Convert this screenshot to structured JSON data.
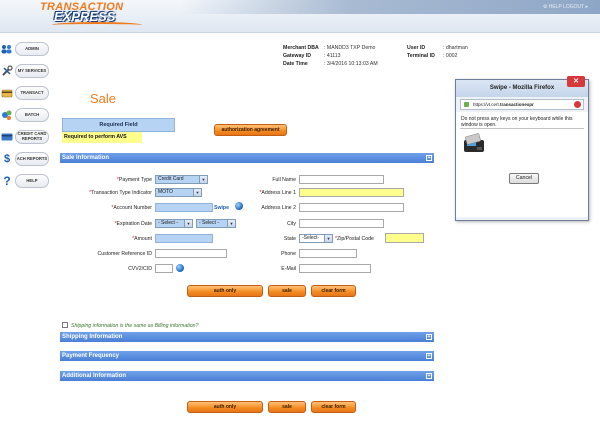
{
  "header": {
    "logo_line1": "TRANSACTION",
    "logo_line2": "EXPRESS",
    "header_links": "⚙ HELP     LOGOUT ▸"
  },
  "nav": {
    "items": [
      {
        "label": "ADMIN",
        "icon": "people-icon"
      },
      {
        "label": "MY SERVICES",
        "icon": "tools-icon"
      },
      {
        "label": "TRANSACT",
        "icon": "transact-icon"
      },
      {
        "label": "BATCH",
        "icon": "batch-icon"
      },
      {
        "label": "CREDIT CARD REPORTS",
        "icon": "card-icon"
      },
      {
        "label": "ACH REPORTS",
        "icon": "dollar-icon"
      },
      {
        "label": "HELP",
        "icon": "question-icon"
      }
    ]
  },
  "merchant": {
    "dba_label": "Merchant DBA",
    "dba_value": ": MANDD3 TXP Demo",
    "gateway_label": "Gateway ID",
    "gateway_value": ": 41113",
    "datetime_label": "Date Time",
    "datetime_value": ": 3/4/2016 10:13:03 AM",
    "user_label": "User ID",
    "user_value": ": dhartman",
    "terminal_label": "Terminal ID",
    "terminal_value": ": 0002"
  },
  "page": {
    "title": "Sale",
    "required_field": "Required Field",
    "required_avs": "Required to perform AVS",
    "auth_agreement": "authorization agreement"
  },
  "sections": {
    "sale_info": "Sale Information",
    "shipping_info": "Shipping Information",
    "payment_frequency": "Payment Frequency",
    "additional_info": "Additional Information",
    "expand": "+"
  },
  "form": {
    "payment_type_label": "Payment Type",
    "payment_type_value": "Credit Card",
    "tti_label": "Transaction Type Indicator",
    "tti_value": "MOTO",
    "account_label": "Account Number",
    "swipe_label": "Swipe",
    "expiration_label": "Expiration Date",
    "exp_month": "- Select -",
    "exp_year": "- Select -",
    "amount_label": "Amount",
    "customer_ref_label": "Customer Reference ID",
    "cvv_label": "CVV2/CID",
    "full_name_label": "Full Name",
    "address1_label": "Address Line 1",
    "address2_label": "Address Line 2",
    "city_label": "City",
    "state_label": "State",
    "state_value": "-Select-",
    "zip_label": "Zip/Postal Code",
    "phone_label": "Phone",
    "email_label": "E-Mail",
    "required_mark": "*"
  },
  "buttons": {
    "auth_only": "auth only",
    "sale": "sale",
    "clear_form": "clear form"
  },
  "shipping": {
    "same_as_billing": "Shipping information is the same as Billing information?"
  },
  "popup": {
    "title": "Swipe - Mozilla Firefox",
    "url_prefix": "https://vt.cert.",
    "url_host": "transactionexpr",
    "message": "Do not press any keys on your keyboard while this window is open.",
    "cancel": "Cancel",
    "close": "✕"
  },
  "colors": {
    "accent_orange": "#f07a1c",
    "section_blue": "#4a7fd6",
    "required_yellow": "#ffff8c",
    "field_blue": "#b7d3f3"
  }
}
